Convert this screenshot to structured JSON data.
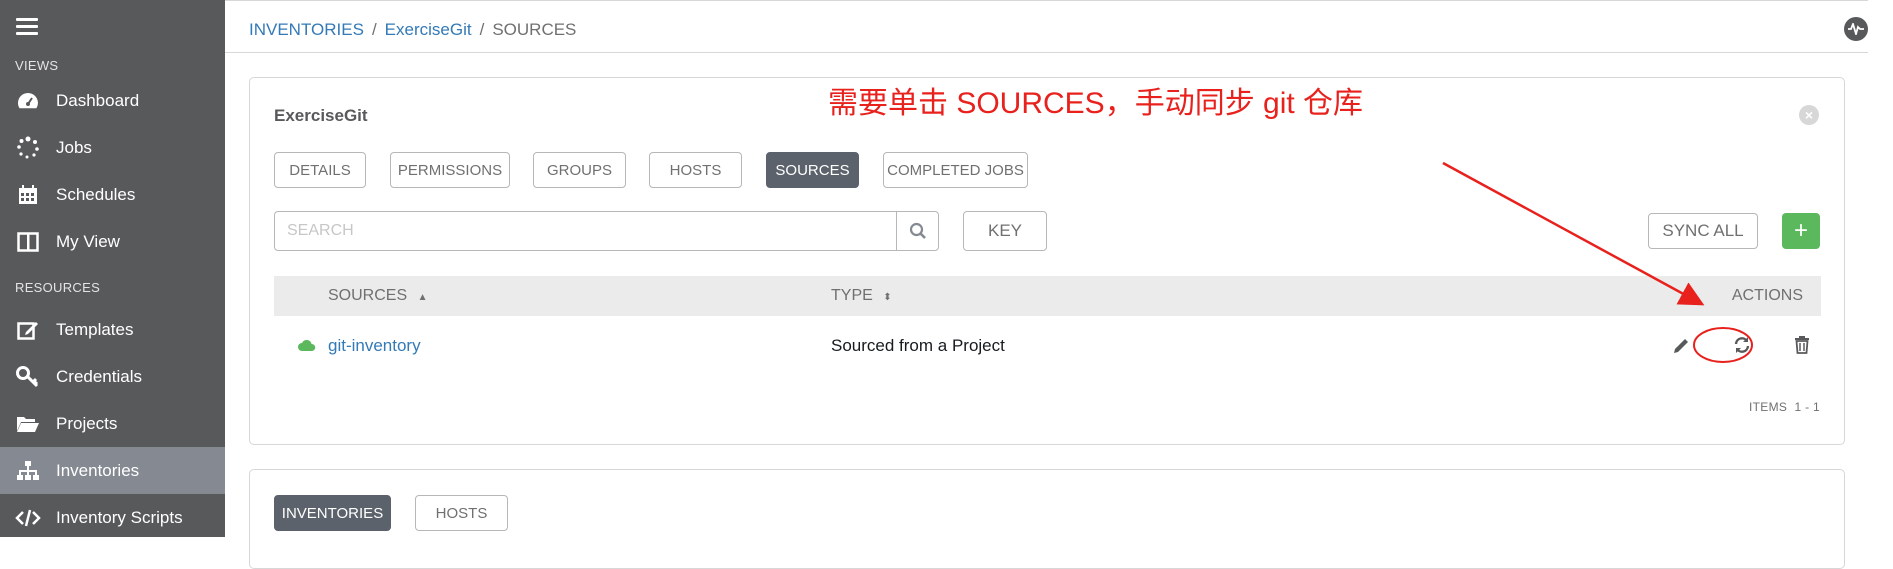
{
  "sidebar": {
    "views_label": "VIEWS",
    "resources_label": "RESOURCES",
    "views": [
      {
        "label": "Dashboard",
        "icon": "dashboard-icon"
      },
      {
        "label": "Jobs",
        "icon": "jobs-spinner-icon"
      },
      {
        "label": "Schedules",
        "icon": "calendar-icon"
      },
      {
        "label": "My View",
        "icon": "columns-icon"
      }
    ],
    "resources": [
      {
        "label": "Templates",
        "icon": "edit-icon"
      },
      {
        "label": "Credentials",
        "icon": "key-icon"
      },
      {
        "label": "Projects",
        "icon": "folder-icon"
      },
      {
        "label": "Inventories",
        "icon": "sitemap-icon",
        "active": true
      },
      {
        "label": "Inventory Scripts",
        "icon": "code-icon"
      }
    ]
  },
  "breadcrumb": {
    "items": [
      "INVENTORIES",
      "ExerciseGit",
      "SOURCES"
    ],
    "sep": "/"
  },
  "panel": {
    "title": "ExerciseGit",
    "tabs": [
      "DETAILS",
      "PERMISSIONS",
      "GROUPS",
      "HOSTS",
      "SOURCES",
      "COMPLETED JOBS"
    ],
    "active_tab": "SOURCES",
    "search_placeholder": "SEARCH",
    "key_label": "KEY",
    "sync_all_label": "SYNC ALL",
    "add_label": "+",
    "columns": {
      "sources": "SOURCES",
      "type": "TYPE",
      "actions": "ACTIONS"
    },
    "rows": [
      {
        "name": "git-inventory",
        "type": "Sourced from a Project",
        "status": "cloud-icon"
      }
    ],
    "items_label": "ITEMS",
    "items_range": "1 - 1"
  },
  "panel2": {
    "tabs": [
      "INVENTORIES",
      "HOSTS"
    ],
    "active_tab": "INVENTORIES"
  },
  "annotation": {
    "text": "需要单击 SOURCES，手动同步 git 仓库",
    "color": "#e8211d"
  },
  "colors": {
    "sidebar": "#58595b",
    "active_nav": "#848992",
    "link": "#337ab7",
    "add_green": "#5cb85c",
    "active_tab": "#5b626b"
  }
}
